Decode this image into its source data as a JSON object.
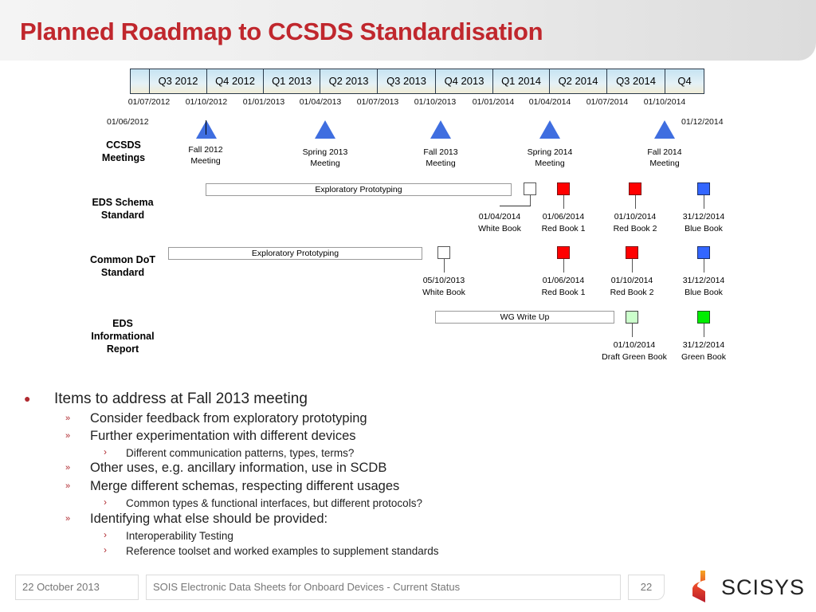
{
  "title": "Planned Roadmap to CCSDS Standardisation",
  "quarters": [
    "",
    "Q3 2012",
    "Q4 2012",
    "Q1 2013",
    "Q2 2013",
    "Q3 2013",
    "Q4 2013",
    "Q1 2014",
    "Q2 2014",
    "Q3 2014",
    "Q4"
  ],
  "date_ticks": [
    "01/07/2012",
    "01/10/2012",
    "01/01/2013",
    "01/04/2013",
    "01/07/2013",
    "01/10/2013",
    "01/01/2014",
    "01/04/2014",
    "01/07/2014",
    "01/10/2014"
  ],
  "range_start": "01/06/2012",
  "range_end": "01/12/2014",
  "rows": {
    "meetings": "CCSDS\nMeetings",
    "eds_schema": "EDS Schema\nStandard",
    "common_dot": "Common DoT\nStandard",
    "eds_info": "EDS\nInformational\nReport"
  },
  "meetings": [
    {
      "line1": "Fall 2012",
      "line2": "Meeting"
    },
    {
      "line1": "Spring 2013",
      "line2": "Meeting"
    },
    {
      "line1": "Fall 2013",
      "line2": "Meeting"
    },
    {
      "line1": "Spring 2014",
      "line2": "Meeting"
    },
    {
      "line1": "Fall 2014",
      "line2": "Meeting"
    }
  ],
  "eds_schema": {
    "bar": "Exploratory Prototyping",
    "milestones": [
      {
        "date": "01/04/2014",
        "label": "White Book",
        "color": "#ffffff"
      },
      {
        "date": "01/06/2014",
        "label": "Red Book 1",
        "color": "#ff0000"
      },
      {
        "date": "01/10/2014",
        "label": "Red Book 2",
        "color": "#ff0000"
      },
      {
        "date": "31/12/2014",
        "label": "Blue Book",
        "color": "#3366ff"
      }
    ]
  },
  "common_dot": {
    "bar": "Exploratory Prototyping",
    "milestones": [
      {
        "date": "05/10/2013",
        "label": "White Book",
        "color": "#ffffff"
      },
      {
        "date": "01/06/2014",
        "label": "Red Book 1",
        "color": "#ff0000"
      },
      {
        "date": "01/10/2014",
        "label": "Red Book 2",
        "color": "#ff0000"
      },
      {
        "date": "31/12/2014",
        "label": "Blue Book",
        "color": "#3366ff"
      }
    ]
  },
  "eds_info": {
    "bar": "WG Write Up",
    "milestones": [
      {
        "date": "01/10/2014",
        "label": "Draft Green Book",
        "color": "#ccffcc"
      },
      {
        "date": "31/12/2014",
        "label": "Green Book",
        "color": "#00ee00"
      }
    ]
  },
  "bullets": {
    "main": "Items to address at Fall 2013 meeting",
    "items": [
      "Consider feedback from exploratory prototyping",
      "Further experimentation with different devices",
      "Different communication patterns, types, terms?",
      "Other uses, e.g. ancillary information, use in SCDB",
      "Merge different schemas, respecting different usages",
      "Common types & functional interfaces, but different protocols?",
      "Identifying what else should be provided:",
      "Interoperability Testing",
      "Reference toolset and worked examples to supplement standards"
    ]
  },
  "footer": {
    "date": "22 October 2013",
    "title": "SOIS Electronic Data Sheets for Onboard Devices - Current Status",
    "page": "22",
    "logo": "SCISYS"
  },
  "colors": {
    "title": "#c0272d",
    "meeting_triangle": "#3f6ee0",
    "red_book": "#ff0000",
    "blue_book": "#3366ff",
    "green_book": "#00ee00",
    "draft_green": "#ccffcc"
  }
}
